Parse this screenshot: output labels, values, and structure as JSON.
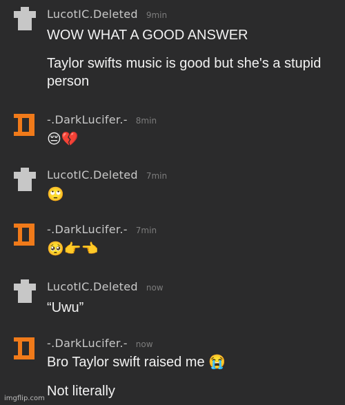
{
  "comments": [
    {
      "username": "LucotIC.Deleted",
      "time": "9min",
      "avatar": "gray-tshirt-icon",
      "lines": [
        "WOW WHAT A GOOD ANSWER",
        "Taylor swifts music is good but she's a stupid person"
      ]
    },
    {
      "username": "-.DarkLucifer.-",
      "time": "8min",
      "avatar": "orange-pixel-icon",
      "lines": [
        "😔💔"
      ]
    },
    {
      "username": "LucotIC.Deleted",
      "time": "7min",
      "avatar": "gray-tshirt-icon",
      "lines": [
        "🙄"
      ]
    },
    {
      "username": "-.DarkLucifer.-",
      "time": "7min",
      "avatar": "orange-pixel-icon",
      "lines": [
        "🥺👉👈"
      ]
    },
    {
      "username": "LucotIC.Deleted",
      "time": "now",
      "avatar": "gray-tshirt-icon",
      "lines": [
        "“Uwu”"
      ]
    },
    {
      "username": "-.DarkLucifer.-",
      "time": "now",
      "avatar": "orange-pixel-icon",
      "lines": [
        "Bro Taylor swift raised me 😭",
        "Not literally"
      ]
    }
  ],
  "watermark": "imgflip.com",
  "colors": {
    "background": "#2b2b2c",
    "username": "#c9c9c9",
    "time": "#7d7d7d",
    "text": "#f2f2f2",
    "orange_avatar": "#f07a1a",
    "gray_avatar": "#c7c7c7"
  }
}
